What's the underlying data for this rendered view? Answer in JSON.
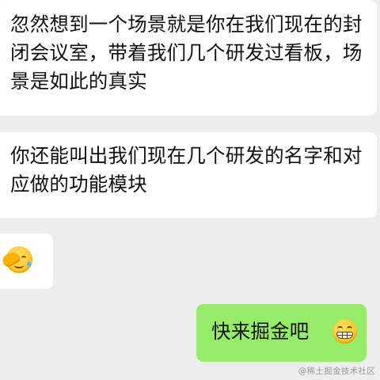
{
  "messages": [
    {
      "side": "incoming",
      "text": "忽然想到一个场景就是你在我们现在的封闭会议室，带着我们几个研发过看板，场景是如此的真实"
    },
    {
      "side": "incoming",
      "text": "你还能叫出我们现在几个研发的名字和对应做的功能模块"
    },
    {
      "side": "incoming",
      "emoji": "facepalm-emoji"
    },
    {
      "side": "outgoing",
      "text": "快来掘金吧",
      "emoji": "grin-emoji"
    }
  ],
  "watermark": "@稀土掘金技术社区",
  "colors": {
    "background": "#ededed",
    "incoming_bubble": "#ffffff",
    "outgoing_bubble": "#95ec69",
    "text": "#111111"
  }
}
